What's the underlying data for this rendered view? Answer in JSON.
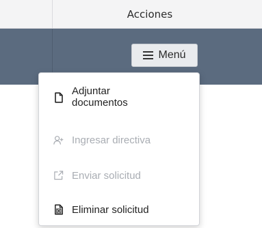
{
  "table": {
    "header": {
      "actions_label": "Acciones"
    }
  },
  "menu_button": {
    "label": "Menú",
    "icon": "hamburger-icon"
  },
  "dropdown": {
    "items": [
      {
        "label_line1": "Adjuntar",
        "label_line2": "documentos",
        "icon": "document-icon",
        "enabled": true
      },
      {
        "label": "Ingresar directiva",
        "icon": "add-user-icon",
        "enabled": false
      },
      {
        "label": "Enviar solicitud",
        "icon": "external-link-icon",
        "enabled": false
      },
      {
        "label": "Eliminar solicitud",
        "icon": "file-delete-icon",
        "enabled": true
      }
    ]
  },
  "colors": {
    "header_bg": "#f4f4f5",
    "row_selected_bg": "#5b6b7f",
    "button_bg": "#e9ebee",
    "text_enabled": "#222222",
    "text_disabled": "#a9adb3"
  }
}
